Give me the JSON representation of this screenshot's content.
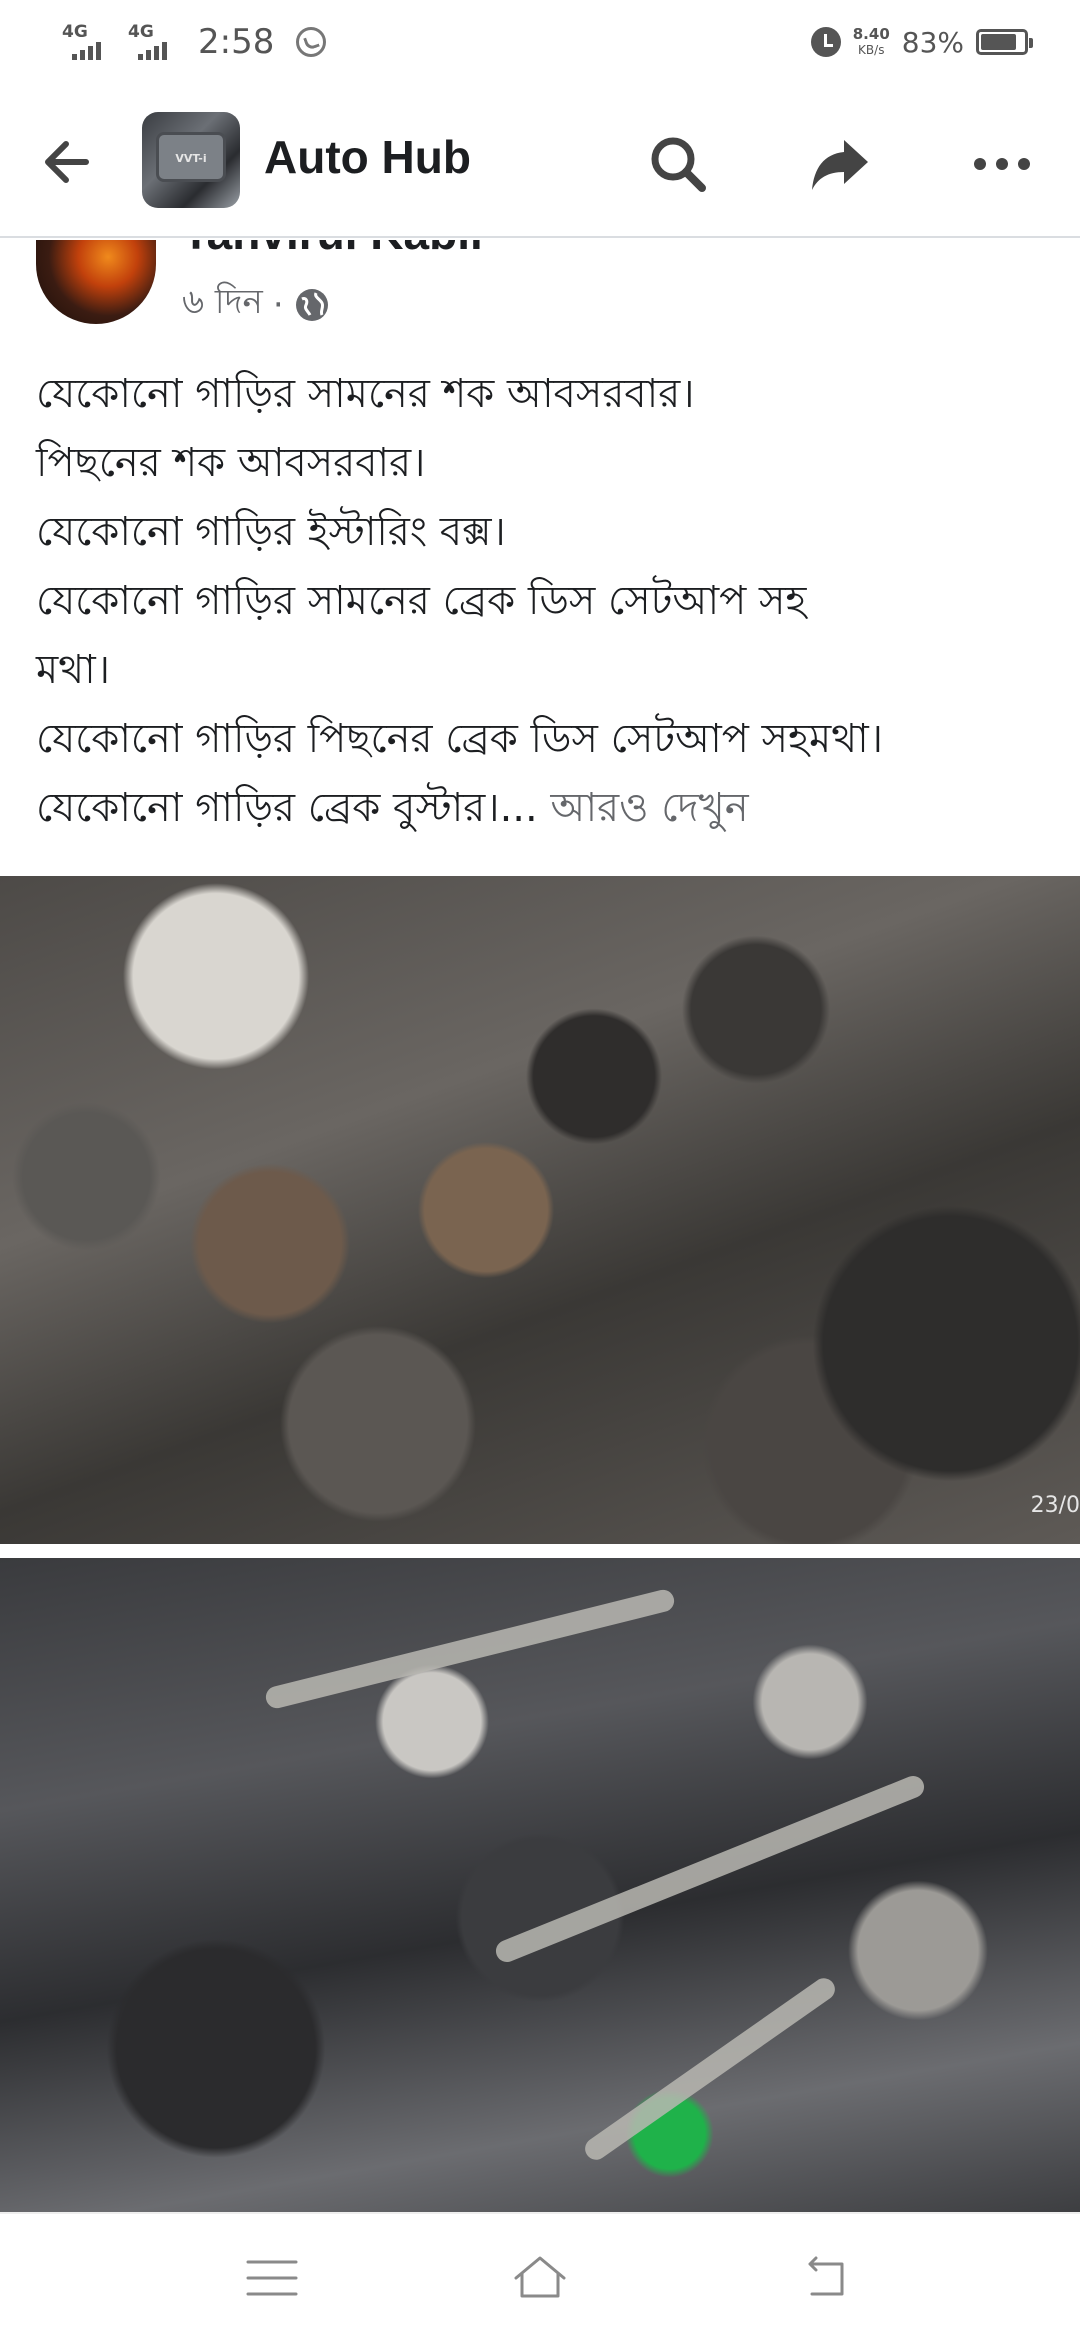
{
  "status_bar": {
    "network_1": "4G",
    "network_2": "4G",
    "time": "2:58",
    "speed_value": "8.40",
    "speed_unit": "KB/s",
    "battery": "83%",
    "battery_level": 0.83,
    "icons": [
      "whatsapp-icon",
      "alarm-icon",
      "battery-icon"
    ]
  },
  "header": {
    "group_name": "Auto Hub",
    "avatar_text": "VVT-i",
    "icons": [
      "back-arrow-icon",
      "search-icon",
      "share-icon",
      "more-icon"
    ]
  },
  "post": {
    "author": "Tanvirul Kabir",
    "time": "৬ দিন",
    "separator": "·",
    "lines": [
      "যেকোনো গাড়ির সামনের শক আবসরবার।",
      "পিছনের শক আবসরবার।",
      "যেকোনো গাড়ির ইস্টারিং বক্স।",
      "যেকোনো গাড়ির সামনের ব্রেক ডিস সেটআপ সহ",
      "মথা।",
      "যেকোনো গাড়ির পিছনের ব্রেক ডিস সেটআপ সহমথা।",
      "যেকোনো গাড়ির ব্রেক বুস্টার।..."
    ],
    "see_more": "আরও দেখুন",
    "photo_tag": "23/0"
  },
  "nav_bar": {
    "icons": [
      "menu-icon",
      "home-icon",
      "back-icon"
    ]
  }
}
